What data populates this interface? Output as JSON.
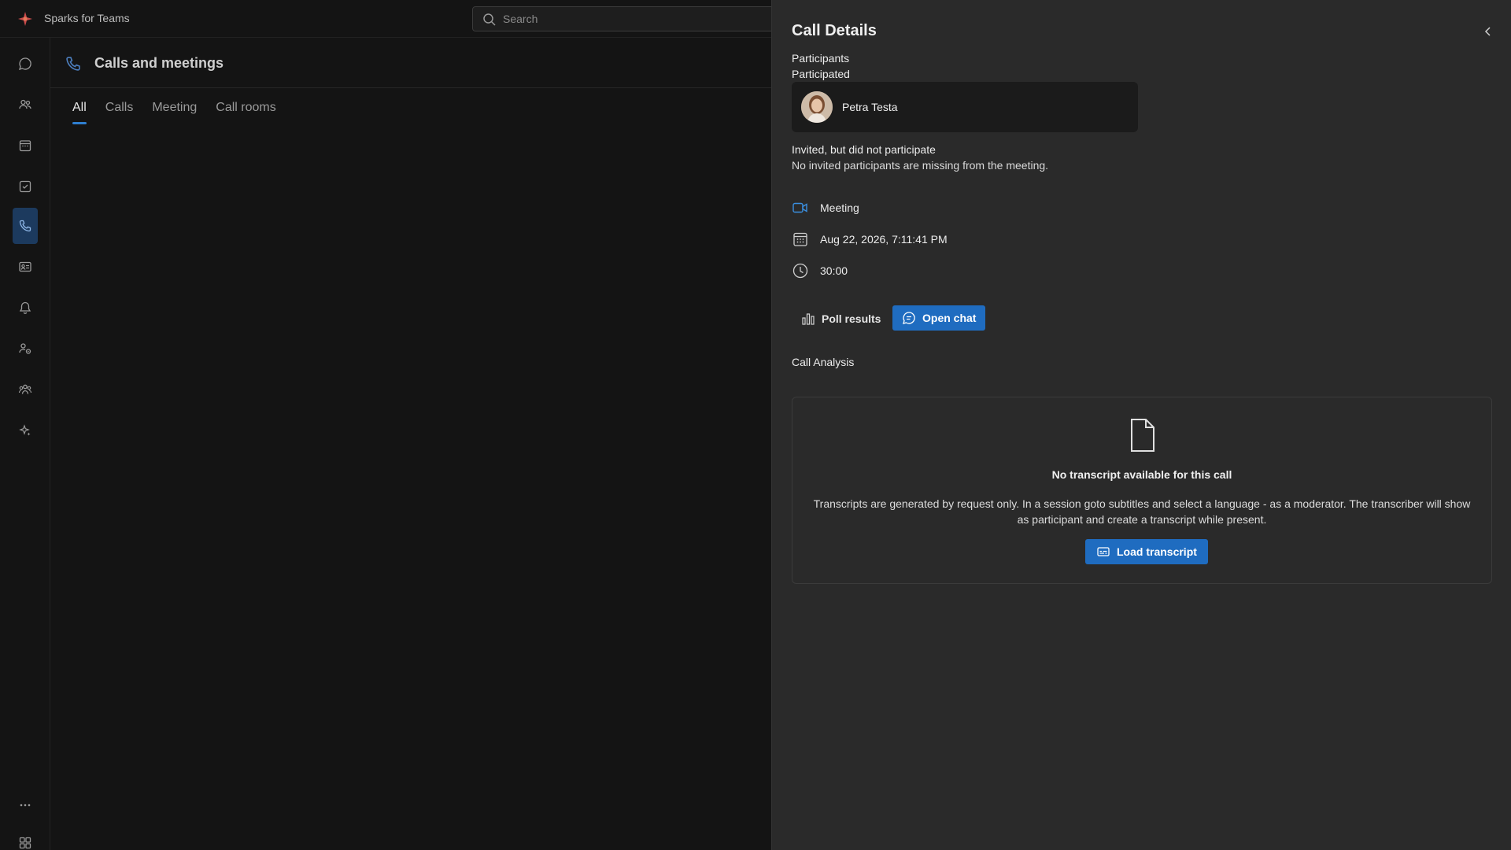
{
  "app": {
    "title": "Sparks for Teams"
  },
  "search": {
    "placeholder": "Search"
  },
  "rail": {
    "items": [
      {
        "icon": "chat-icon"
      },
      {
        "icon": "people-icon"
      },
      {
        "icon": "calendar-icon"
      },
      {
        "icon": "tasks-icon"
      },
      {
        "icon": "phone-icon",
        "active": true
      },
      {
        "icon": "contact-card-icon"
      },
      {
        "icon": "bell-icon"
      },
      {
        "icon": "user-settings-icon"
      },
      {
        "icon": "teams-icon"
      },
      {
        "icon": "sparkle-icon"
      }
    ],
    "bottom": [
      {
        "icon": "more-icon"
      },
      {
        "icon": "apps-icon"
      }
    ]
  },
  "main": {
    "title": "Calls and meetings",
    "tabs": [
      {
        "label": "All",
        "active": true
      },
      {
        "label": "Calls"
      },
      {
        "label": "Meeting"
      },
      {
        "label": "Call rooms"
      }
    ]
  },
  "details": {
    "title": "Call Details",
    "participants_label": "Participants",
    "participated_label": "Participated",
    "participant": {
      "name": "Petra Testa"
    },
    "invited_label": "Invited, but did not participate",
    "invited_message": "No invited participants are missing from the meeting.",
    "meeting_type": "Meeting",
    "datetime": "Aug 22, 2026, 7:11:41 PM",
    "duration": "30:00",
    "poll_results_label": "Poll results",
    "open_chat_label": "Open chat",
    "call_analysis_label": "Call Analysis",
    "transcript": {
      "title": "No transcript available for this call",
      "description": "Transcripts are generated by request only. In a session goto subtitles and select a language - as a moderator. The transcriber will show as participant and create a transcript while present.",
      "load_label": "Load transcript"
    }
  },
  "colors": {
    "accent": "#1f6cc0",
    "panel_bg": "#2a2a2a",
    "app_bg": "#141414",
    "active_rail": "#1c3a5e"
  }
}
